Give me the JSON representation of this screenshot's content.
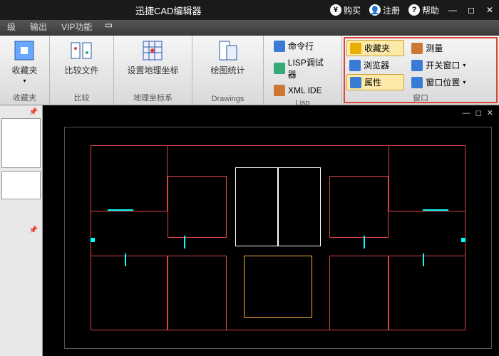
{
  "title": "迅捷CAD编辑器",
  "titlebar": {
    "buy": "购买",
    "register": "注册",
    "help": "帮助"
  },
  "tabs": [
    "级",
    "输出",
    "VIP功能"
  ],
  "ribbon": {
    "g1": {
      "label": "收藏夹",
      "caption": "收藏夹"
    },
    "g2": {
      "label": "比较文件",
      "caption": "比较"
    },
    "g3": {
      "label": "设置地理坐标",
      "caption": "地理坐标系"
    },
    "g4": {
      "label": "绘图统计",
      "caption": "Drawings"
    },
    "lisp": {
      "a": "命令行",
      "b": "LISP调试器",
      "c": "XML IDE",
      "caption": "Lisp"
    },
    "win": {
      "a": "收藏夹",
      "b": "测量",
      "c": "浏览器",
      "d": "开关窗口",
      "e": "属性",
      "f": "窗口位置",
      "caption": "窗口"
    }
  }
}
